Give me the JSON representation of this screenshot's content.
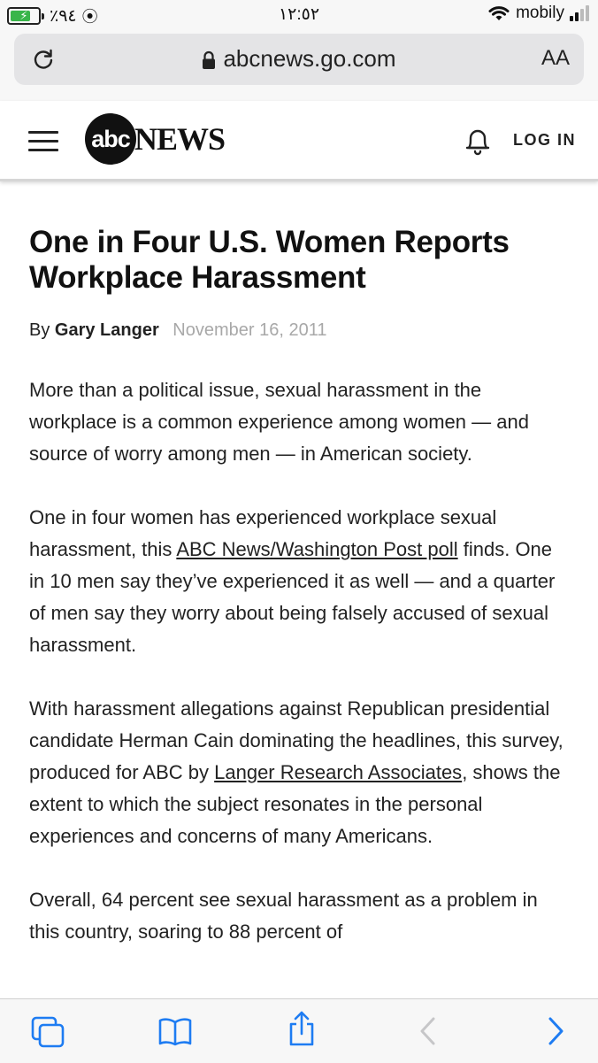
{
  "status_bar": {
    "battery_percent": "٪٩٤",
    "time": "١٢:٥٢",
    "carrier": "mobily",
    "battery_level": 0.94
  },
  "browser": {
    "url": "abcnews.go.com",
    "text_size_label": "AA",
    "icons": [
      "reload-icon",
      "lock-icon",
      "tabs-icon",
      "bookmarks-icon",
      "share-icon",
      "back-icon",
      "forward-icon"
    ]
  },
  "site_header": {
    "logo_abc": "abc",
    "logo_news": "NEWS",
    "login_label": "LOG IN",
    "icons": [
      "menu-icon",
      "bell-icon"
    ]
  },
  "article": {
    "title": "One in Four U.S. Women Reports Workplace Harassment",
    "byline_prefix": "By",
    "author": "Gary Langer",
    "date": "November 16, 2011",
    "p1": "More than a political issue, sexual harassment in the workplace is a common experience among women — and source of worry among men — in American society.",
    "p2_a": "One in four women has experienced workplace sexual harassment, this ",
    "p2_link": "ABC News/Washington Post poll",
    "p2_b": " finds. One in 10 men say they’ve experienced it as well — and a quarter of men say they worry about being falsely accused of sexual harassment.",
    "p3_a": "With harassment allegations against Republican presidential candidate Herman Cain dominating the headlines, this survey, produced for ABC by ",
    "p3_link": "Langer Research Associates",
    "p3_b": ", shows the extent to which the subject resonates in the personal experiences and concerns of many Americans.",
    "p4": "Overall, 64 percent see sexual harassment as a problem in this country, soaring to 88 percent of"
  },
  "colors": {
    "accent_blue": "#1e7cf2",
    "battery_green": "#39b54a",
    "date_gray": "#a8a8a8"
  }
}
